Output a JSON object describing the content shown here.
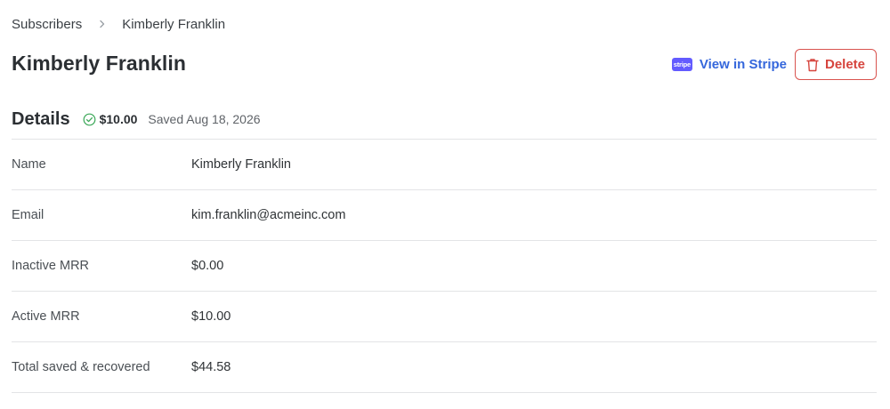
{
  "breadcrumb": {
    "parent": "Subscribers",
    "separator_icon": "chevron-right-icon",
    "current": "Kimberly Franklin"
  },
  "page_title": "Kimberly Franklin",
  "actions": {
    "stripe_logo_text": "stripe",
    "view_in_stripe": "View in Stripe",
    "delete": "Delete",
    "delete_icon": "trash-icon",
    "link_color": "#3567dc",
    "danger_color": "#d6453e",
    "stripe_brand_color": "#635bff"
  },
  "details": {
    "title": "Details",
    "status_icon": "check-circle-icon",
    "status_color": "#3aa757",
    "amount": "$10.00",
    "saved_text": "Saved Aug 18, 2026"
  },
  "rows": [
    {
      "label": "Name",
      "value": "Kimberly Franklin"
    },
    {
      "label": "Email",
      "value": "kim.franklin@acmeinc.com"
    },
    {
      "label": "Inactive MRR",
      "value": "$0.00"
    },
    {
      "label": "Active MRR",
      "value": "$10.00"
    },
    {
      "label": "Total saved & recovered",
      "value": "$44.58"
    }
  ]
}
